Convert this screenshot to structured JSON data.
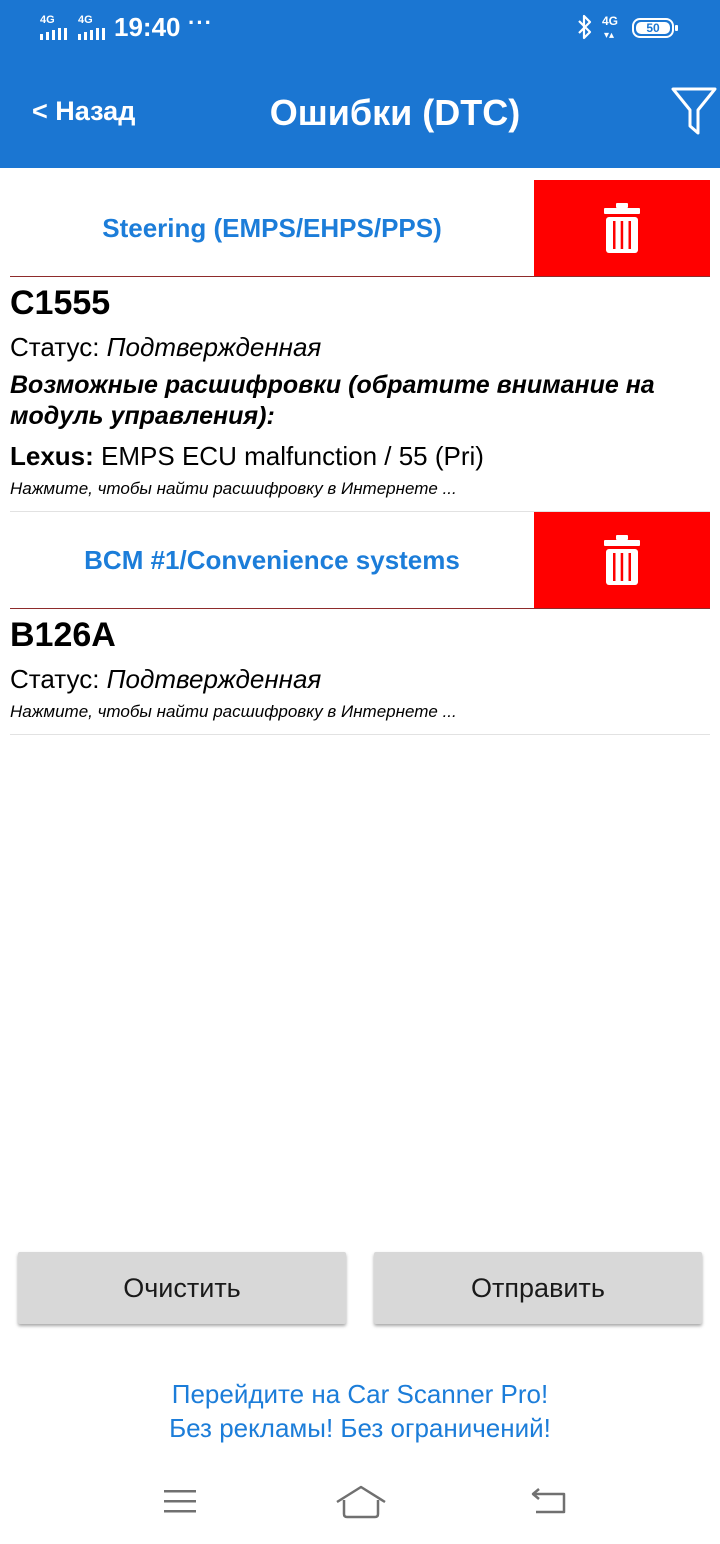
{
  "status_bar": {
    "sim1_label": "4G",
    "sim2_label": "4G",
    "time": "19:40",
    "more_dots": "···",
    "network_label": "4G",
    "battery_level": "50"
  },
  "header": {
    "back_label": "< Назад",
    "title": "Ошибки (DTC)"
  },
  "dtc_groups": [
    {
      "module": "Steering (EMPS/EHPS/PPS)",
      "code": "C1555",
      "status_label": "Статус:",
      "status_value": "Подтвержденная",
      "decode_title": "Возможные расшифровки (обратите внимание на модуль управления):",
      "decode_brand": "Lexus:",
      "decode_text": "EMPS ECU malfunction / 55 (Pri)",
      "search_hint": "Нажмите, чтобы найти расшифровку в Интернете ..."
    },
    {
      "module": "BCM #1/Convenience systems",
      "code": "B126A",
      "status_label": "Статус:",
      "status_value": "Подтвержденная",
      "search_hint": "Нажмите, чтобы найти расшифровку в Интернете ..."
    }
  ],
  "actions": {
    "clear_label": "Очистить",
    "send_label": "Отправить"
  },
  "promo": {
    "line1": "Перейдите на Car Scanner Pro!",
    "line2": "Без рекламы! Без ограничений!"
  },
  "colors": {
    "header_bg": "#1b76d2",
    "link_blue": "#1c7dd9",
    "delete_red": "#ff0000",
    "button_grey": "#d8d8d8"
  },
  "icons": {
    "filter": "filter-icon",
    "delete": "trash-icon",
    "menu": "menu-icon",
    "home": "home-icon",
    "back": "back-icon"
  }
}
